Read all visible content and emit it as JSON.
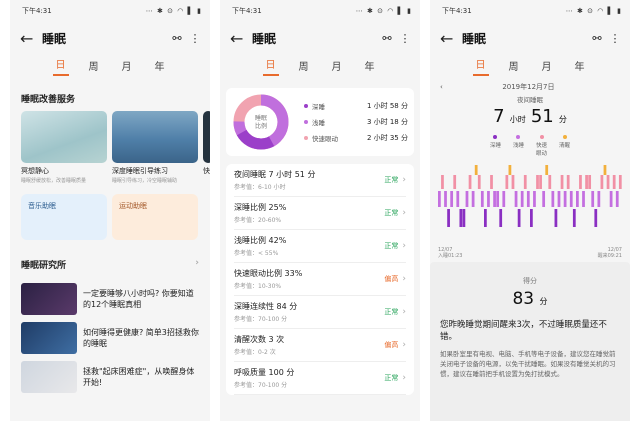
{
  "status": {
    "time": "下午4:31",
    "icons": "⋯ ✱ ⊙ ◠ ▌ ▮"
  },
  "app": {
    "title": "睡眠"
  },
  "tabs": [
    "日",
    "周",
    "月",
    "年"
  ],
  "screen1": {
    "services_title": "睡眠改善服务",
    "cards": [
      {
        "title": "冥想静心",
        "sub": "睡眠舒缓放松，改善睡眠质量"
      },
      {
        "title": "深度睡眠引导练习",
        "sub": "睡眠引导练习，冷空睡眠辅助"
      },
      {
        "title": "快",
        "sub": ""
      }
    ],
    "tiles": [
      {
        "label": "音乐助眠"
      },
      {
        "label": "运动助眠"
      }
    ],
    "research_title": "睡眠研究所",
    "articles": [
      {
        "text": "一定要睡够八小时吗? 你要知道的12个睡眠真相"
      },
      {
        "text": "如何睡得更健康? 简单3招拯救你的睡眠"
      },
      {
        "text": "拯救\"起床困难症\"，从唤醒身体开始!"
      }
    ]
  },
  "screen2": {
    "donut_label": "睡眠\n比例",
    "legend": [
      {
        "name": "深睡",
        "value": "1 小时 58 分",
        "color": "#9b3fc9"
      },
      {
        "name": "浅睡",
        "value": "3 小时 18 分",
        "color": "#c06fdd"
      },
      {
        "name": "快速眼动",
        "value": "2 小时 35 分",
        "color": "#f1a3b0"
      }
    ],
    "metrics": [
      {
        "title": "夜间睡眠  7 小时 51 分",
        "ref": "参考值：6-10 小时",
        "status": "正常",
        "kind": "ok"
      },
      {
        "title": "深睡比例  25%",
        "ref": "参考值：20-60%",
        "status": "正常",
        "kind": "ok"
      },
      {
        "title": "浅睡比例  42%",
        "ref": "参考值：< 55%",
        "status": "正常",
        "kind": "ok"
      },
      {
        "title": "快速眼动比例  33%",
        "ref": "参考值：10-30%",
        "status": "偏高",
        "kind": "hi"
      },
      {
        "title": "深睡连续性  84 分",
        "ref": "参考值：70-100 分",
        "status": "正常",
        "kind": "ok"
      },
      {
        "title": "清醒次数  3 次",
        "ref": "参考值：0-2 次",
        "status": "偏高",
        "kind": "hi"
      },
      {
        "title": "呼吸质量  100 分",
        "ref": "参考值：70-100 分",
        "status": "正常",
        "kind": "ok"
      }
    ]
  },
  "screen3": {
    "date": "2019年12月7日",
    "subtitle": "夜间睡眠",
    "hours": "7",
    "hours_unit": "小时",
    "minutes": "51",
    "minutes_unit": "分",
    "legend": [
      {
        "name": "深睡",
        "color": "#8a2fc2"
      },
      {
        "name": "浅睡",
        "color": "#c46fe0"
      },
      {
        "name": "快速\n眼动",
        "color": "#f190a5"
      },
      {
        "name": "清醒",
        "color": "#f2b03c"
      }
    ],
    "start_label": "12/07\n入睡01:23",
    "end_label": "12/07\n醒来09:21",
    "score_label": "得分",
    "score": "83",
    "score_unit": "分",
    "verdict": "您昨晚睡觉期间醒来3次，不过睡眠质量还不错。",
    "advice": "如果卧室里有电视、电脑、手机等电子设备，建议您在睡觉前关闭电子设备的电源，以免干扰睡眠。如果没有睡觉关机的习惯，建议在睡前把手机设置为免打扰模式。"
  }
}
